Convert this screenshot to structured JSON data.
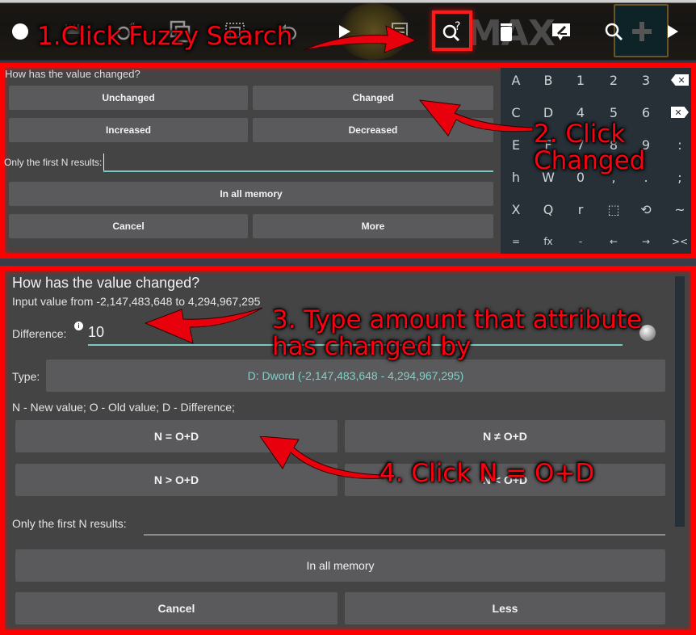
{
  "toolbar": {
    "icons": [
      {
        "name": "float-ball-icon",
        "glyph": "●"
      },
      {
        "name": "memory-editor-icon",
        "glyph": "▬"
      },
      {
        "name": "search-number-icon",
        "glyph": "○#"
      },
      {
        "name": "copy-icon",
        "glyph": "⧉"
      },
      {
        "name": "select-icon",
        "glyph": "⬚"
      },
      {
        "name": "undo-icon",
        "glyph": "↶"
      },
      {
        "name": "play-icon",
        "glyph": "▶"
      },
      {
        "name": "save-list-icon",
        "glyph": "≡"
      },
      {
        "name": "fuzzy-search-icon",
        "glyph": "Q?"
      },
      {
        "name": "delete-icon",
        "glyph": "🗑"
      },
      {
        "name": "edit-comment-icon",
        "glyph": "✎"
      },
      {
        "name": "search-icon",
        "glyph": "🔍"
      },
      {
        "name": "add-icon",
        "glyph": "+"
      },
      {
        "name": "more-arrow-icon",
        "glyph": "▶"
      }
    ],
    "background_text": "MAX"
  },
  "annotations": {
    "step1": "1.Click Fuzzy Search",
    "step2_line1": "2. Click",
    "step2_line2": "Changed",
    "step3_line1": "3. Type amount that attribute",
    "step3_line2": "has changed by",
    "step4": "4. Click N = O+D",
    "color": "#ff0010"
  },
  "top_dialog": {
    "title": "How has the value changed?",
    "buttons": {
      "unchanged": "Unchanged",
      "changed": "Changed",
      "increased": "Increased",
      "decreased": "Decreased",
      "in_all_memory": "In all memory",
      "cancel": "Cancel",
      "more": "More"
    },
    "first_n_label": "Only the first N results:",
    "first_n_value": ""
  },
  "keypad": {
    "rows": [
      [
        "A",
        "B",
        "1",
        "2",
        "3",
        "⌫"
      ],
      [
        "C",
        "D",
        "4",
        "5",
        "6",
        "⌦"
      ],
      [
        "E",
        "F",
        "7",
        "8",
        "9",
        ":"
      ],
      [
        "h",
        "W",
        "0",
        ",",
        ".",
        ";"
      ],
      [
        "X",
        "Q",
        "r",
        "⬚",
        "⟲",
        "~"
      ],
      [
        "=",
        "fx",
        "-",
        "←",
        "→",
        "><"
      ]
    ]
  },
  "bottom_dialog": {
    "title": "How has the value changed?",
    "range_text": "Input value from -2,147,483,648 to 4,294,967,295",
    "difference_label": "Difference:",
    "difference_value": "10",
    "info_glyph": "i",
    "type_label": "Type:",
    "type_value": "D: Dword (-2,147,483,648 - 4,294,967,295)",
    "legend": "N - New value; O - Old value; D - Difference;",
    "buttons": {
      "eq": "N = O+D",
      "neq": "N ≠ O+D",
      "gt": "N > O+D",
      "lt": "N < O+D",
      "in_all_memory": "In all memory",
      "cancel": "Cancel",
      "less": "Less"
    },
    "first_n_label": "Only the first N results:",
    "first_n_value": ""
  },
  "colors": {
    "accent_teal": "#7cc7bf",
    "highlight_red": "#ff0000",
    "button_bg": "#5a5a5c",
    "dialog_bg": "#444444",
    "keypad_bg": "#263036"
  }
}
